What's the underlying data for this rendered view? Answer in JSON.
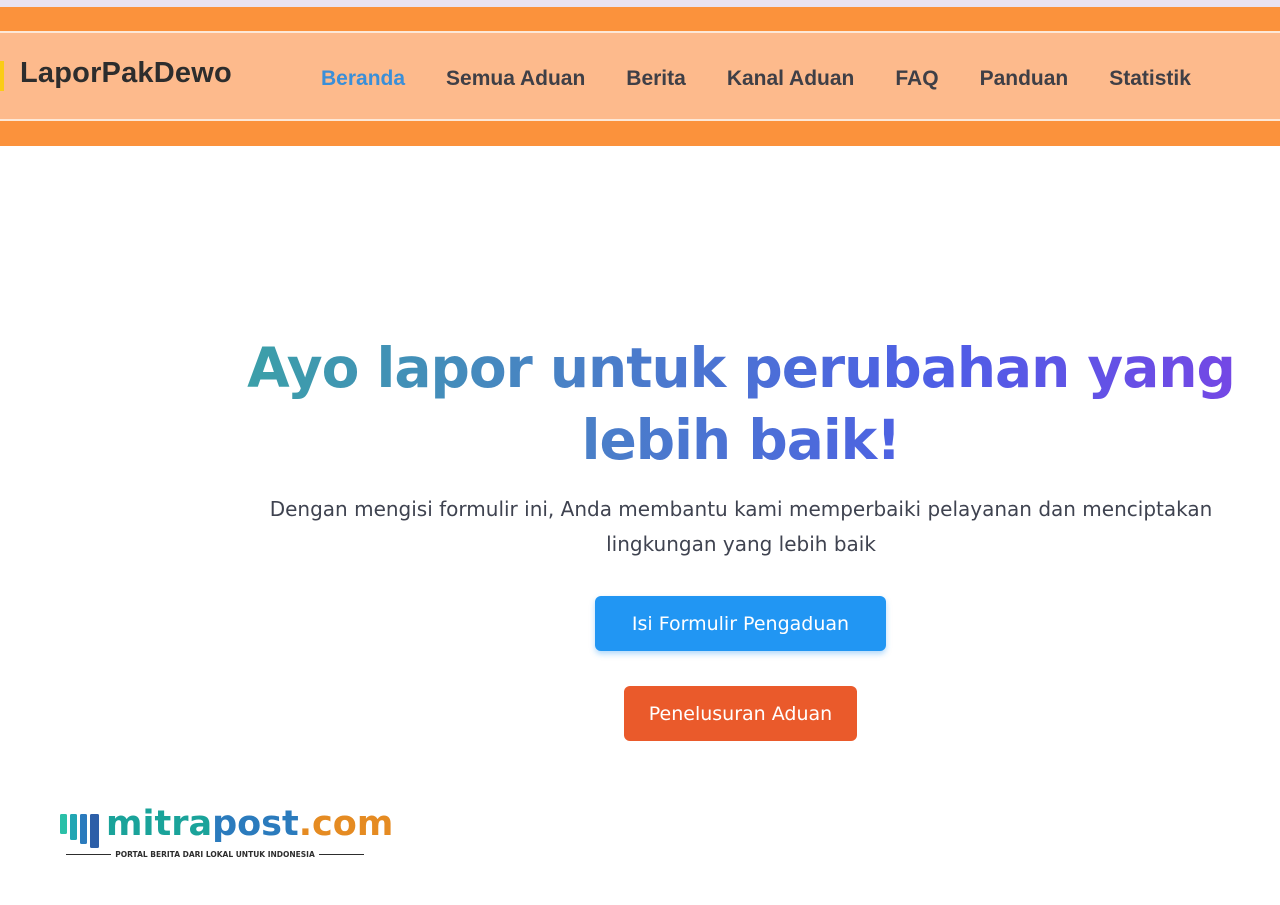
{
  "navbar": {
    "brand": "LaporPakDewo",
    "links": [
      {
        "label": "Beranda",
        "active": true
      },
      {
        "label": "Semua Aduan"
      },
      {
        "label": "Berita"
      },
      {
        "label": "Kanal Aduan"
      },
      {
        "label": "FAQ"
      },
      {
        "label": "Panduan"
      },
      {
        "label": "Statistik"
      }
    ]
  },
  "hero": {
    "title_line1": "Ayo lapor untuk perubahan yang",
    "title_line2": "lebih baik!",
    "subtitle_line1": "Dengan mengisi formulir ini, Anda membantu kami memperbaiki pelayanan dan menciptakan",
    "subtitle_line2": "lingkungan yang lebih baik"
  },
  "buttons": {
    "primary": "Isi Formulir Pengaduan",
    "secondary": "Penelusuran Aduan"
  },
  "watermark": {
    "mitra": "mitra",
    "post": "post",
    "dot": ".",
    "com": "com",
    "tagline": "PORTAL BERITA DARI LOKAL UNTUK INDONESIA"
  },
  "colors": {
    "nav_band": "#fb923c",
    "nav_bar": "#fdba8c",
    "active_link": "#3b8fd8",
    "primary_button": "#2196f3",
    "secondary_button": "#ea5a2b"
  }
}
